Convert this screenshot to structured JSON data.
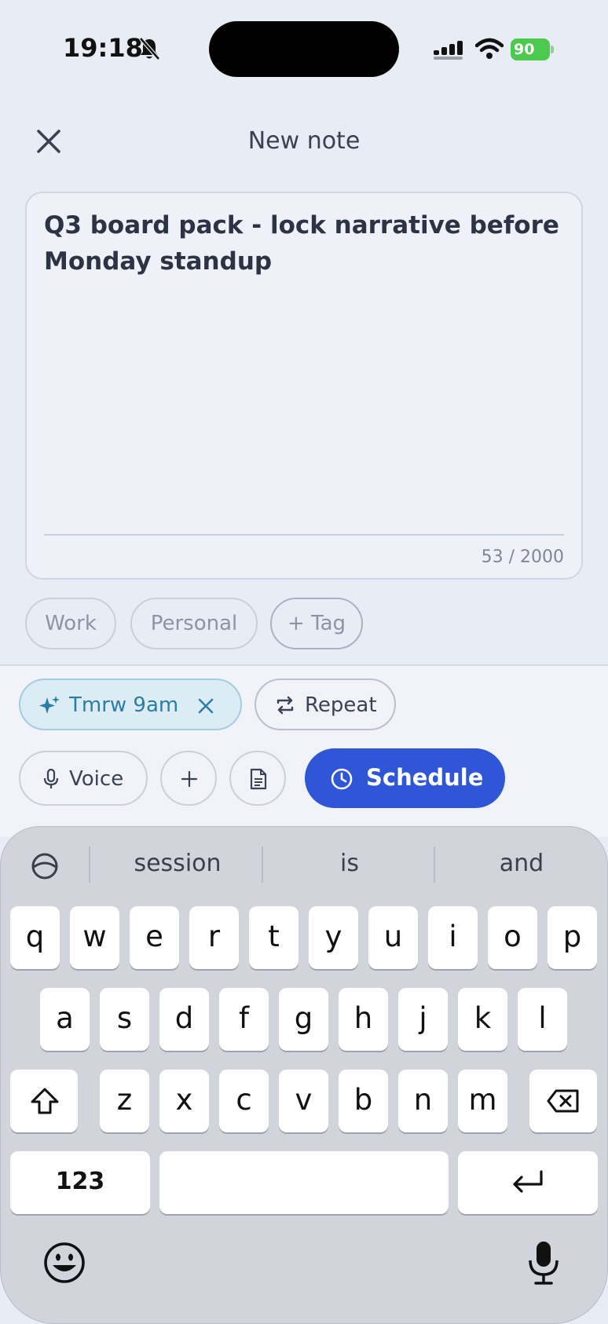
{
  "status": {
    "time": "19:18",
    "battery": "90"
  },
  "header": {
    "title": "New note"
  },
  "note": {
    "text": "Q3 board pack - lock narrative before Monday standup",
    "counter": "53 / 2000"
  },
  "tags": [
    "Work",
    "Personal",
    "+ Tag"
  ],
  "reminder_chip": {
    "label": "Tmrw 9am"
  },
  "repeat_chip": {
    "label": "Repeat"
  },
  "actions": {
    "voice": "Voice",
    "schedule": "Schedule"
  },
  "keyboard": {
    "suggestions": [
      "session",
      "is",
      "and"
    ],
    "row1": [
      "q",
      "w",
      "e",
      "r",
      "t",
      "y",
      "u",
      "i",
      "o",
      "p"
    ],
    "row2": [
      "a",
      "s",
      "d",
      "f",
      "g",
      "h",
      "j",
      "k",
      "l"
    ],
    "row3": [
      "z",
      "x",
      "c",
      "v",
      "b",
      "n",
      "m"
    ],
    "numbers_key": "123"
  },
  "icons": {
    "close": "close-icon",
    "bell_muted": "bell-muted-icon",
    "signal": "signal-icon",
    "wifi": "wifi-icon",
    "sparkle": "sparkle-icon",
    "repeat": "repeat-icon",
    "mic": "microphone-icon",
    "plus": "plus-icon",
    "document": "document-icon",
    "clock": "clock-icon",
    "globe": "grammarly-icon",
    "shift": "shift-icon",
    "backspace": "backspace-icon",
    "return": "return-icon",
    "emoji": "emoji-icon"
  },
  "colors": {
    "accent": "#2f56d6",
    "chip_bg": "#dcecf5",
    "chip_text": "#2a7ea5",
    "battery": "#4cc94f"
  }
}
